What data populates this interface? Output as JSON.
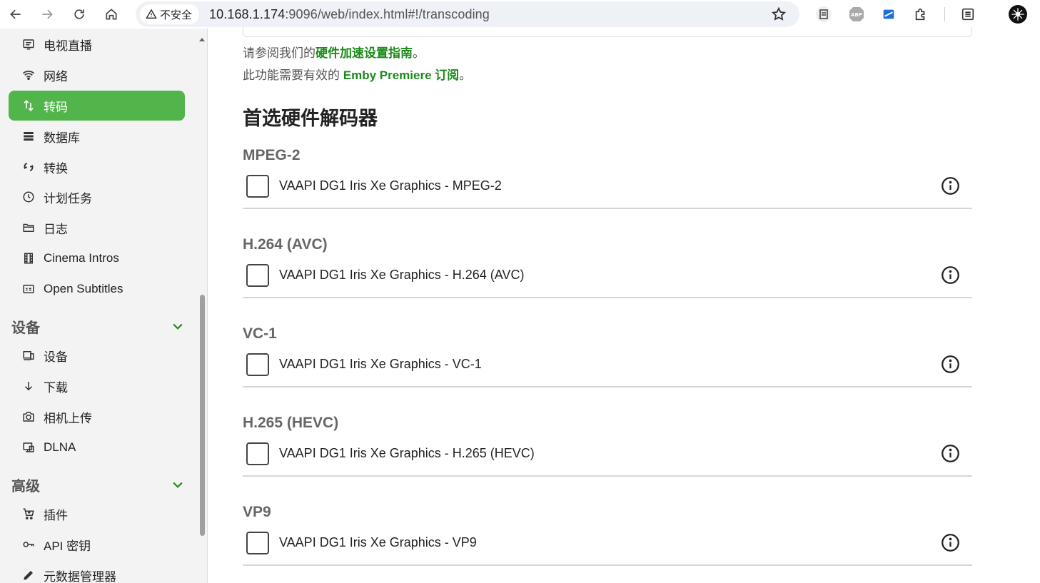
{
  "browser": {
    "security_label": "不安全",
    "url_host": "10.168.1.174",
    "url_rest": ":9096/web/index.html#!/transcoding"
  },
  "sidebar": {
    "items_top": [
      {
        "label": "电视直播",
        "icon": "tv-list-icon"
      },
      {
        "label": "网络",
        "icon": "wifi-icon"
      },
      {
        "label": "转码",
        "icon": "transcode-icon",
        "active": true
      },
      {
        "label": "数据库",
        "icon": "database-icon"
      },
      {
        "label": "转换",
        "icon": "convert-icon"
      },
      {
        "label": "计划任务",
        "icon": "clock-icon"
      },
      {
        "label": "日志",
        "icon": "folder-icon"
      },
      {
        "label": "Cinema Intros",
        "icon": "film-icon"
      },
      {
        "label": "Open Subtitles",
        "icon": "subtitles-icon"
      }
    ],
    "section_devices": "设备",
    "items_devices": [
      {
        "label": "设备",
        "icon": "devices-icon"
      },
      {
        "label": "下载",
        "icon": "download-arrow-icon"
      },
      {
        "label": "相机上传",
        "icon": "camera-icon"
      },
      {
        "label": "DLNA",
        "icon": "dlna-icon"
      }
    ],
    "section_advanced": "高级",
    "items_advanced": [
      {
        "label": "插件",
        "icon": "cart-icon"
      },
      {
        "label": "API 密钥",
        "icon": "key-icon"
      },
      {
        "label": "元数据管理器",
        "icon": "pencil-icon"
      }
    ]
  },
  "main": {
    "note1_prefix": "请参阅我们的",
    "note1_link": "硬件加速设置指南",
    "note1_suffix": "。",
    "note2_prefix": "此功能需要有效的 ",
    "note2_link": "Emby Premiere 订阅",
    "note2_suffix": "。",
    "section_title": "首选硬件解码器",
    "codecs": [
      {
        "name": "MPEG-2",
        "label": "VAAPI DG1 Iris Xe Graphics - MPEG-2",
        "checked": false
      },
      {
        "name": "H.264 (AVC)",
        "label": "VAAPI DG1 Iris Xe Graphics - H.264 (AVC)",
        "checked": false
      },
      {
        "name": "VC-1",
        "label": "VAAPI DG1 Iris Xe Graphics - VC-1",
        "checked": false
      },
      {
        "name": "H.265 (HEVC)",
        "label": "VAAPI DG1 Iris Xe Graphics - H.265 (HEVC)",
        "checked": false
      },
      {
        "name": "VP9",
        "label": "VAAPI DG1 Iris Xe Graphics - VP9",
        "checked": false
      }
    ]
  },
  "colors": {
    "accent": "#52b54b",
    "link": "#1b8a1b"
  }
}
